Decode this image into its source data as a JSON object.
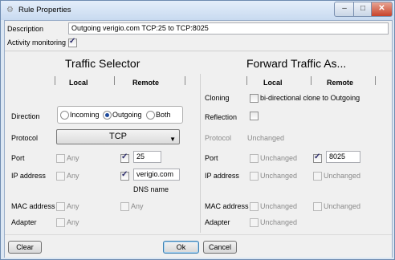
{
  "window": {
    "title": "Rule Properties",
    "app_icon": "gear-icon"
  },
  "description": {
    "label": "Description",
    "value": "Outgoing verigio.com TCP:25 to TCP:8025"
  },
  "activity_monitoring": {
    "label": "Activity monitoring",
    "checked": true
  },
  "traffic_selector": {
    "title": "Traffic Selector",
    "col_local": "Local",
    "col_remote": "Remote",
    "direction": {
      "label": "Direction",
      "options": [
        "Incoming",
        "Outgoing",
        "Both"
      ],
      "selected": "Outgoing"
    },
    "protocol": {
      "label": "Protocol",
      "value": "TCP"
    },
    "port": {
      "label": "Port",
      "local_any": "Any",
      "remote_value": "25"
    },
    "ip_address": {
      "label": "IP address",
      "local_any": "Any",
      "remote_value": "verigio.com",
      "remote_hint": "DNS name"
    },
    "mac_address": {
      "label": "MAC address",
      "local_any": "Any",
      "remote_any": "Any"
    },
    "adapter": {
      "label": "Adapter",
      "local_any": "Any"
    }
  },
  "forward": {
    "title": "Forward Traffic As...",
    "col_local": "Local",
    "col_remote": "Remote",
    "cloning": {
      "label": "Cloning",
      "option": "bi-directional clone to Outgoing"
    },
    "reflection": {
      "label": "Reflection"
    },
    "protocol": {
      "label": "Protocol",
      "value": "Unchanged"
    },
    "port": {
      "label": "Port",
      "local": "Unchanged",
      "remote_value": "8025"
    },
    "ip_address": {
      "label": "IP address",
      "local": "Unchanged",
      "remote": "Unchanged"
    },
    "mac_address": {
      "label": "MAC address",
      "local": "Unchanged",
      "remote": "Unchanged"
    },
    "adapter": {
      "label": "Adapter",
      "local": "Unchanged"
    }
  },
  "buttons": {
    "clear": "Clear",
    "ok": "Ok",
    "cancel": "Cancel"
  }
}
